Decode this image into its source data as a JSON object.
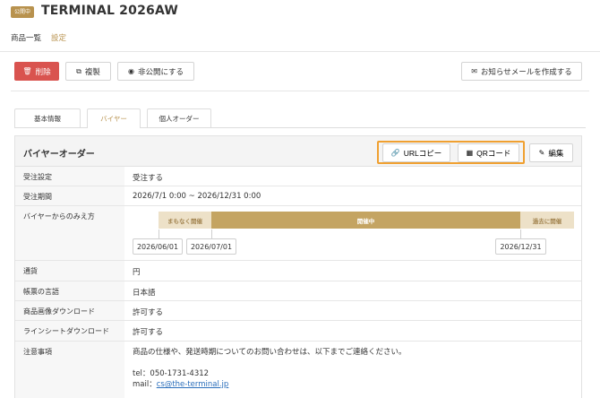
{
  "header": {
    "badge": "公開中",
    "title": "TERMINAL 2026AW"
  },
  "nav": {
    "items": [
      {
        "label": "商品一覧"
      },
      {
        "label": "設定"
      }
    ]
  },
  "toolbar": {
    "delete_label": "削除",
    "copy_label": "複製",
    "unpublish_label": "非公開にする",
    "mail_label": "お知らせメールを作成する"
  },
  "tabs": [
    {
      "label": "基本情報"
    },
    {
      "label": "バイヤー"
    },
    {
      "label": "個人オーダー"
    }
  ],
  "panel": {
    "title": "バイヤーオーダー",
    "url_copy_label": "URLコピー",
    "qr_label": "QRコード",
    "edit_label": "編集"
  },
  "rows": {
    "order_setting": {
      "key": "受注設定",
      "value": "受注する"
    },
    "order_period": {
      "key": "受注期間",
      "value": "2026/7/1 0:00 ~ 2026/12/31 0:00"
    },
    "buyer_view": {
      "key": "バイヤーからのみえ方"
    },
    "currency": {
      "key": "通貨",
      "value": "円"
    },
    "doc_language": {
      "key": "帳票の言語",
      "value": "日本語"
    },
    "image_download": {
      "key": "商品画像ダウンロード",
      "value": "許可する"
    },
    "linesheet_download": {
      "key": "ラインシートダウンロード",
      "value": "許可する"
    },
    "notes": {
      "key": "注意事項",
      "line1": "商品の仕様や、発送時期についてのお問い合わせは、以下までご連絡ください。",
      "tel": "tel：050-1731-4312",
      "mail_prefix": "mail：",
      "mail_link": "cs@the-terminal.jp"
    }
  },
  "timeline": {
    "pre_label": "まもなく開催",
    "on_label": "開催中",
    "post_label": "過去に開催",
    "dates": [
      "2026/06/01",
      "2026/07/01",
      "2026/12/31"
    ]
  },
  "colors": {
    "accent": "#b8924e",
    "danger": "#d9534f",
    "highlight": "#f0a030"
  }
}
